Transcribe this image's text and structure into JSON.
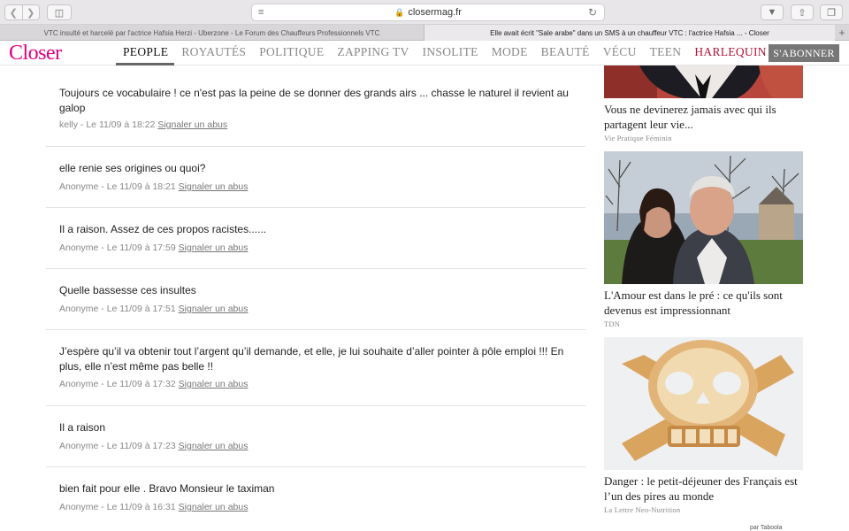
{
  "browser": {
    "url": "closermag.fr",
    "tabs": [
      {
        "label": "VTC insulté et harcelé par l'actrice Hafsia Herzi - Uberzone - Le Forum des Chauffeurs Professionnels VTC"
      },
      {
        "label": "Elle avait écrit \"Sale arabe\" dans un SMS à un chauffeur VTC : l'actrice Hafsia ... - Closer"
      }
    ]
  },
  "site": {
    "logo": "Closer",
    "nav": [
      "PEOPLE",
      "ROYAUTÉS",
      "POLITIQUE",
      "ZAPPING TV",
      "INSOLITE",
      "MODE",
      "BEAUTÉ",
      "VÉCU",
      "TEEN",
      "HARLEQUIN"
    ],
    "subscribe": "S'ABONNER"
  },
  "comments": [
    {
      "text": "Toujours ce vocabulaire ! ce n'est pas la peine de se donner des grands airs ... chasse le naturel il revient au galop",
      "author": "kelly",
      "date": " - Le 11/09 à 18:22 ",
      "report": "Signaler un abus"
    },
    {
      "text": "elle renie ses origines ou quoi?",
      "author": "Anonyme",
      "date": " - Le 11/09 à 18:21 ",
      "report": "Signaler un abus"
    },
    {
      "text": "Il a raison. Assez de ces propos racistes......",
      "author": "Anonyme",
      "date": " - Le 11/09 à 17:59 ",
      "report": "Signaler un abus"
    },
    {
      "text": "Quelle bassesse ces insultes",
      "author": "Anonyme",
      "date": " - Le 11/09 à 17:51 ",
      "report": "Signaler un abus"
    },
    {
      "text": "J’espère qu’il va obtenir tout l’argent qu’il demande, et elle, je lui souhaite d’aller pointer à pôle emploi !!! En plus, elle n’est même pas belle !!",
      "author": "Anonyme",
      "date": " - Le 11/09 à 17:32 ",
      "report": "Signaler un abus"
    },
    {
      "text": "Il a raison",
      "author": "Anonyme",
      "date": " - Le 11/09 à 17:23 ",
      "report": "Signaler un abus"
    },
    {
      "text": "bien fait pour elle . Bravo Monsieur le taximan",
      "author": "Anonyme",
      "date": " - Le 11/09 à 16:31 ",
      "report": "Signaler un abus"
    }
  ],
  "sidebar": [
    {
      "title": "Vous ne devinerez jamais avec qui ils partagent leur vie...",
      "source": "Vie Pratique Féminin"
    },
    {
      "title": "L'Amour est dans le pré : ce qu'ils sont devenus est impressionnant",
      "source": "TDN"
    },
    {
      "title": "Danger : le petit-déjeuner des Français est l’un des pires au monde",
      "source": "La Lettre Neo-Nutrition"
    }
  ],
  "taboola": "par Taboola"
}
